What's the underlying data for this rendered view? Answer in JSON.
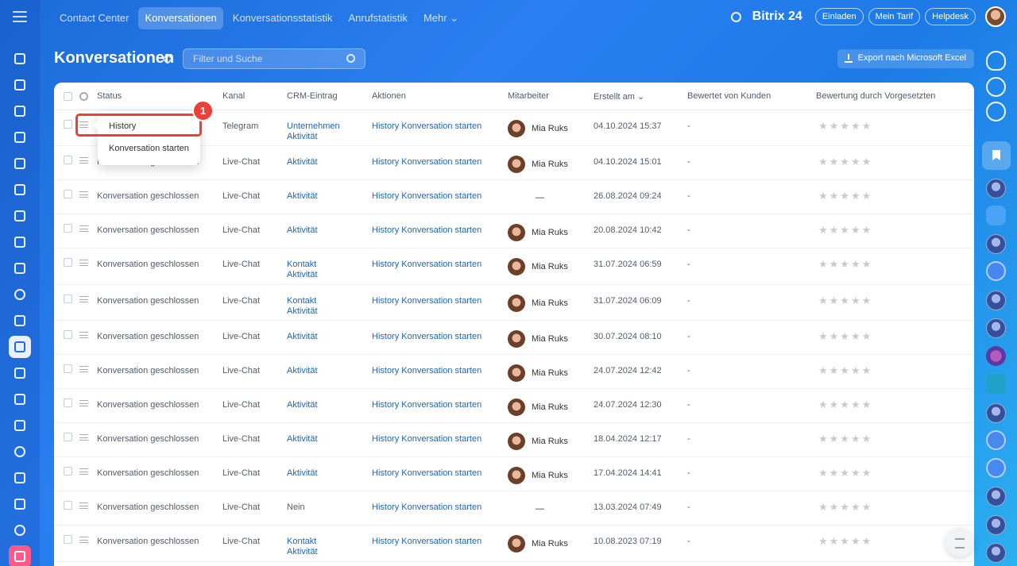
{
  "top_nav": {
    "tabs": [
      "Contact Center",
      "Konversationen",
      "Konversationsstatistik",
      "Anrufstatistik",
      "Mehr ⌄"
    ],
    "active_tab": "Konversationen",
    "brand": "Bitrix 24",
    "buttons": [
      "Einladen",
      "Mein Tarif",
      "Helpdesk"
    ]
  },
  "page": {
    "title": "Konversationen",
    "search_placeholder": "Filter und Suche",
    "export_label": "Export nach Microsoft Excel"
  },
  "table": {
    "headers": {
      "status": "Status",
      "channel": "Kanal",
      "crm": "CRM-Eintrag",
      "actions": "Aktionen",
      "employee": "Mitarbeiter",
      "created": "Erstellt am ⌄",
      "client_rating": "Bewertet von Kunden",
      "supervisor_rating": "Bewertung durch Vorgesetzten"
    },
    "rows": [
      {
        "status": "",
        "channel": "Telegram",
        "crm1": "Unternehmen",
        "crm2": "Aktivität",
        "employee": "Mia Ruks",
        "created": "04.10.2024 15:37",
        "client": "-"
      },
      {
        "status": "Konversation geschlossen",
        "channel": "Live-Chat",
        "crm1": "Aktivität",
        "crm2": "",
        "employee": "Mia Ruks",
        "created": "04.10.2024 15:01",
        "client": "-"
      },
      {
        "status": "Konversation geschlossen",
        "channel": "Live-Chat",
        "crm1": "Aktivität",
        "crm2": "",
        "employee": "",
        "created": "26.08.2024 09:24",
        "client": "-"
      },
      {
        "status": "Konversation geschlossen",
        "channel": "Live-Chat",
        "crm1": "Aktivität",
        "crm2": "",
        "employee": "Mia Ruks",
        "created": "20.08.2024 10:42",
        "client": "-"
      },
      {
        "status": "Konversation geschlossen",
        "channel": "Live-Chat",
        "crm1": "Kontakt",
        "crm2": "Aktivität",
        "employee": "Mia Ruks",
        "created": "31.07.2024 06:59",
        "client": "-"
      },
      {
        "status": "Konversation geschlossen",
        "channel": "Live-Chat",
        "crm1": "Kontakt",
        "crm2": "Aktivität",
        "employee": "Mia Ruks",
        "created": "31.07.2024 06:09",
        "client": "-"
      },
      {
        "status": "Konversation geschlossen",
        "channel": "Live-Chat",
        "crm1": "Aktivität",
        "crm2": "",
        "employee": "Mia Ruks",
        "created": "30.07.2024 08:10",
        "client": "-"
      },
      {
        "status": "Konversation geschlossen",
        "channel": "Live-Chat",
        "crm1": "Aktivität",
        "crm2": "",
        "employee": "Mia Ruks",
        "created": "24.07.2024 12:42",
        "client": "-"
      },
      {
        "status": "Konversation geschlossen",
        "channel": "Live-Chat",
        "crm1": "Aktivität",
        "crm2": "",
        "employee": "Mia Ruks",
        "created": "24.07.2024 12:30",
        "client": "-"
      },
      {
        "status": "Konversation geschlossen",
        "channel": "Live-Chat",
        "crm1": "Aktivität",
        "crm2": "",
        "employee": "Mia Ruks",
        "created": "18.04.2024 12:17",
        "client": "-"
      },
      {
        "status": "Konversation geschlossen",
        "channel": "Live-Chat",
        "crm1": "Aktivität",
        "crm2": "",
        "employee": "Mia Ruks",
        "created": "17.04.2024 14:41",
        "client": "-"
      },
      {
        "status": "Konversation geschlossen",
        "channel": "Live-Chat",
        "crm1": "Nein",
        "crm2": "",
        "employee": "",
        "created": "13.03.2024 07:49",
        "client": "-"
      },
      {
        "status": "Konversation geschlossen",
        "channel": "Live-Chat",
        "crm1": "Kontakt",
        "crm2": "Aktivität",
        "employee": "Mia Ruks",
        "created": "10.08.2023 07:19",
        "client": "-"
      }
    ],
    "action_history": "History",
    "action_start": "Konversation starten",
    "empty_employee": "—"
  },
  "popup_menu": {
    "items": [
      "History",
      "Konversation starten"
    ]
  },
  "callout_badge": "1",
  "colors": {
    "accent": "#2067b0",
    "highlight": "#e8413a",
    "background": "#1c6bd9"
  }
}
